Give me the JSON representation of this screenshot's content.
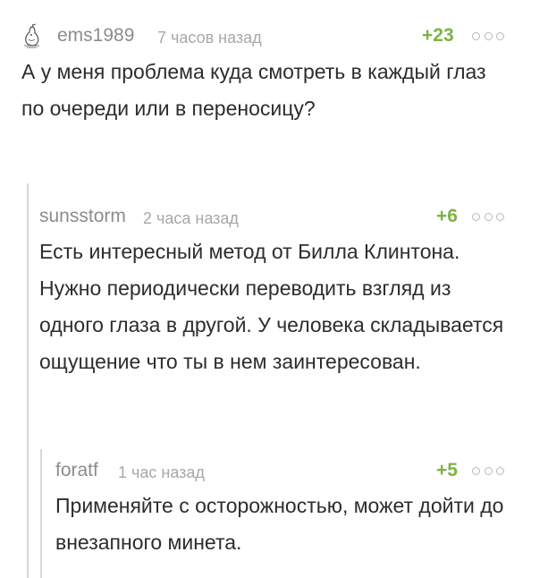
{
  "comments": [
    {
      "author": "ems1989",
      "time": "7 часов назад",
      "rating": "+23",
      "text": "А у меня проблема куда смотреть в каждый глаз по очереди или в переносицу?",
      "avatar_icon": "pear-sketch-avatar-icon"
    },
    {
      "author": "sunsstorm",
      "time": "2 часа назад",
      "rating": "+6",
      "text": "Есть интересный метод от Билла Клинтона. Нужно периодически переводить взгляд из одного глаза в другой. У человека складывается ощущение что ты в нем заинтересован."
    },
    {
      "author": "foratf",
      "time": "1 час назад",
      "rating": "+5",
      "text": "Применяйте с осторожностью, может дойти до внезапного минета."
    }
  ],
  "colors": {
    "rating": "#7cb342",
    "author": "#8c8c8c",
    "time": "#a8a8a8",
    "thread_line": "#d8d8d8"
  }
}
